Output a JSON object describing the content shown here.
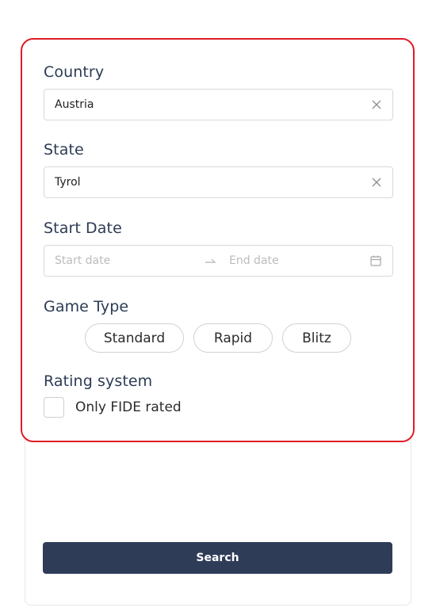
{
  "filters": {
    "country": {
      "label": "Country",
      "value": "Austria"
    },
    "state": {
      "label": "State",
      "value": "Tyrol"
    },
    "start_date": {
      "label": "Start Date",
      "start_placeholder": "Start date",
      "end_placeholder": "End date"
    },
    "game_type": {
      "label": "Game Type",
      "options": [
        "Standard",
        "Rapid",
        "Blitz"
      ]
    },
    "rating_system": {
      "label": "Rating system",
      "checkbox_label": "Only FIDE rated",
      "checked": false
    }
  },
  "actions": {
    "search_label": "Search"
  },
  "colors": {
    "highlight_border": "#de1c27",
    "button_bg": "#2e3c58",
    "heading_text": "#2c3b55"
  },
  "icons": {
    "clear": "close-icon",
    "date_arrow": "arrow-right-icon",
    "calendar": "calendar-icon"
  }
}
